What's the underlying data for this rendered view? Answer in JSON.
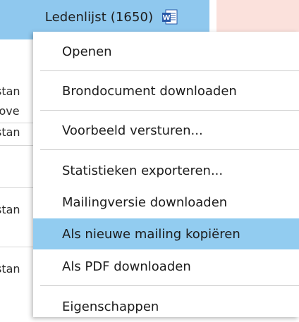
{
  "header": {
    "title": "Ledenlijst (1650)",
    "icon": "word-document-icon",
    "colors": {
      "header_bg": "#8fc8ee",
      "side_bg": "#fbe1dc"
    }
  },
  "background_rows": [
    {
      "text": "stan"
    },
    {
      "text": "love"
    },
    {
      "text": "stan"
    },
    {
      "text": "stan"
    },
    {
      "text": "stan"
    },
    {
      "text": "!"
    }
  ],
  "menu": {
    "items": [
      {
        "label": "Openen"
      },
      {
        "label": "Brondocument downloaden"
      },
      {
        "label": "Voorbeeld versturen..."
      },
      {
        "label": "Statistieken exporteren..."
      },
      {
        "label": "Mailingversie downloaden"
      },
      {
        "label": "Als nieuwe mailing kopiëren",
        "highlighted": true
      },
      {
        "label": "Als PDF downloaden"
      },
      {
        "label": "Eigenschappen"
      }
    ],
    "highlight_color": "#92ccf0"
  }
}
